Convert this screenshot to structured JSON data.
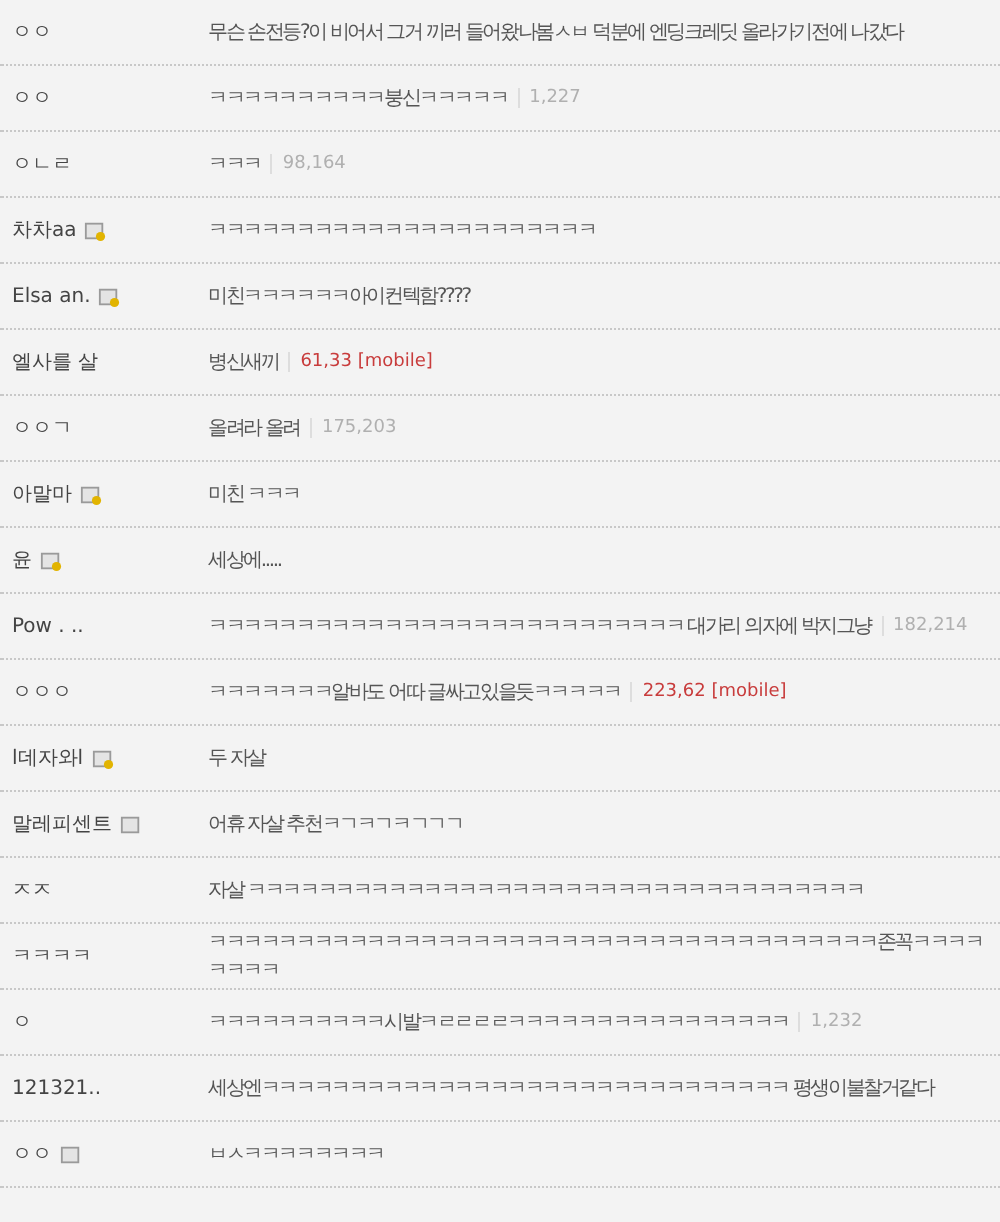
{
  "comments": [
    {
      "name": "ㅇㅇ",
      "kind": "plain",
      "text": "무슨 손전등?이 비어서 그거 끼러 들어왔나봄ㅅㅂ 덕분에 엔딩크레딧 올라가기전에 나갔다"
    },
    {
      "name": "ㅇㅇ",
      "kind": "plain",
      "text": "ㅋㅋㅋㅋㅋㅋㅋㅋㅋㅋ붕신ㅋㅋㅋㅋㅋ",
      "ip": {
        "text": "1,227",
        "mobile": false
      }
    },
    {
      "name": "ㅇㄴㄹ",
      "kind": "plain",
      "text": "ㅋㅋㅋ",
      "ip": {
        "text": "98,164",
        "mobile": false
      }
    },
    {
      "name": "차차aa",
      "kind": "fixed",
      "text": "ㅋㅋㅋㅋㅋㅋㅋㅋㅋㅋㅋㅋㅋㅋㅋㅋㅋㅋㅋㅋㅋㅋ"
    },
    {
      "name": "Elsa an.",
      "kind": "fixed",
      "text": "미친ㅋㅋㅋㅋㅋㅋ아이컨텍함????"
    },
    {
      "name": "엘사를 살",
      "kind": "plain",
      "text": "병신새끼",
      "ip": {
        "text": "61,33 [mobile]",
        "mobile": true
      }
    },
    {
      "name": "ㅇㅇㄱ",
      "kind": "plain",
      "text": "올려라 올려",
      "ip": {
        "text": "175,203",
        "mobile": false
      }
    },
    {
      "name": "아말마",
      "kind": "fixed",
      "text": "미친 ㅋㅋㅋ"
    },
    {
      "name": "윤",
      "kind": "fixed",
      "text": "세상에....."
    },
    {
      "name": "Pow . ..",
      "kind": "plain",
      "text": "ㅋㅋㅋㅋㅋㅋㅋㅋㅋㅋㅋㅋㅋㅋㅋㅋㅋㅋㅋㅋㅋㅋㅋㅋㅋㅋㅋ 대가리 의자에 박지그냥",
      "ip": {
        "text": "182,214",
        "mobile": false
      }
    },
    {
      "name": "ㅇㅇㅇ",
      "kind": "plain",
      "text": "ㅋㅋㅋㅋㅋㅋㅋ알바도 어따 글싸고있을듯ㅋㅋㅋㅋㅋ",
      "ip": {
        "text": "223,62 [mobile]",
        "mobile": true
      }
    },
    {
      "name": "l데자와l",
      "kind": "fixed",
      "text": "두 자살"
    },
    {
      "name": "말레피센트",
      "kind": "member",
      "text": "어휴 자살 추천ㅋㄱㅋㄱㅋㄱㄱㄱ"
    },
    {
      "name": "ㅈㅈ",
      "kind": "plain",
      "text": "자살 ㅋㅋㅋㅋㅋㅋㅋㅋㅋㅋㅋㅋㅋㅋㅋㅋㅋㅋㅋㅋㅋㅋㅋㅋㅋㅋㅋㅋㅋㅋㅋㅋㅋㅋㅋ"
    },
    {
      "name": "ㅋㅋㅋㅋ",
      "kind": "plain",
      "text": "ㅋㅋㅋㅋㅋㅋㅋㅋㅋㅋㅋㅋㅋㅋㅋㅋㅋㅋㅋㅋㅋㅋㅋㅋㅋㅋㅋㅋㅋㅋㅋㅋㅋㅋㅋㅋㅋㅋ존꼭ㅋㅋㅋㅋㅋㅋㅋㅋ"
    },
    {
      "name": "ㅇ",
      "kind": "plain",
      "text": "ㅋㅋㅋㅋㅋㅋㅋㅋㅋㅋ시발ㅋㄹㄹㄹㄹㅋㅋㅋㅋㅋㅋㅋㅋㅋㅋㅋㅋㅋㅋㅋㅋ",
      "ip": {
        "text": "1,232",
        "mobile": false
      }
    },
    {
      "name": "121321..",
      "kind": "plain",
      "text": "세상엔ㅋㅋㅋㅋㅋㅋㅋㅋㅋㅋㅋㅋㅋㅋㅋㅋㅋㅋㅋㅋㅋㅋㅋㅋㅋㅋㅋㅋㅋㅋ 평생이불찰거같다"
    },
    {
      "name": "ㅇㅇ",
      "kind": "member",
      "text": "ㅂㅅㅋㅋㅋㅋㅋㅋㅋㅋ"
    }
  ]
}
